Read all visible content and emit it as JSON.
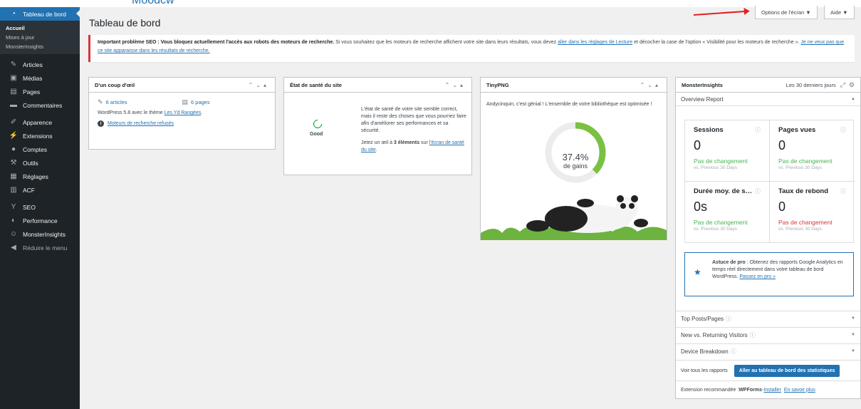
{
  "brand_fragment": "Moodcw",
  "sidebar": {
    "dashboard_label": "Tableau de bord",
    "submenu": [
      "Accueil",
      "Mises à jour",
      "MonsterInsights"
    ],
    "items": [
      {
        "label": "Articles",
        "icon": "pin-icon"
      },
      {
        "label": "Médias",
        "icon": "media-icon"
      },
      {
        "label": "Pages",
        "icon": "pages-icon"
      },
      {
        "label": "Commentaires",
        "icon": "comments-icon"
      },
      {
        "label": "Apparence",
        "icon": "appearance-icon"
      },
      {
        "label": "Extensions",
        "icon": "plugins-icon"
      },
      {
        "label": "Comptes",
        "icon": "users-icon"
      },
      {
        "label": "Outils",
        "icon": "tools-icon"
      },
      {
        "label": "Réglages",
        "icon": "settings-icon"
      },
      {
        "label": "ACF",
        "icon": "acf-icon"
      },
      {
        "label": "SEO",
        "icon": "seo-icon"
      },
      {
        "label": "Performance",
        "icon": "performance-icon"
      },
      {
        "label": "MonsterInsights",
        "icon": "monsterinsights-icon"
      },
      {
        "label": "Réduire le menu",
        "icon": "collapse-icon"
      }
    ]
  },
  "header": {
    "title": "Tableau de bord",
    "screen_options": "Options de l'écran ▼",
    "help": "Aide ▼"
  },
  "notice": {
    "bold": "Important problème SEO : Vous bloquez actuellement l'accès aux robots des moteurs de recherche.",
    "text1": " Si vous souhaitez que les moteurs de recherche affichent votre site dans leurs résultats, vous devez ",
    "link1": "aller dans les réglages de Lecture",
    "text2": " et décocher la case de l'option « Visibilité pour les moteurs de recherche ». ",
    "link2": "Je ne veux pas que ce site apparaisse dans les résultats de recherche."
  },
  "glance": {
    "title": "D'un coup d'œil",
    "articles": "6 articles",
    "pages": "6 pages",
    "version_text": "WordPress 5.8 avec le thème ",
    "theme_link": "Les Yd Rangées",
    "theme_after": ".",
    "seo_link": "Moteurs de recherche refusés"
  },
  "health": {
    "title": "État de santé du site",
    "status": "Good",
    "p1": "L'état de santé de votre site semble correct, mais il reste des choses que vous pourriez faire afin d'améliorer ses performances et sa sécurité.",
    "p2_a": "Jetez un œil à ",
    "p2_b": "3 éléments",
    "p2_c": " sur ",
    "p2_link": "l'écran de santé du site",
    "p2_d": "."
  },
  "tinypng": {
    "title": "TinyPNG",
    "message": "Andycinquin, c'est génial ! L'ensemble de votre bibliothèque est optimisée !",
    "percent_label": "37.4%",
    "percent_value": 37.4,
    "gains_label": "de gains"
  },
  "monsterinsights": {
    "title": "MonsterInsights",
    "period": "Les 30 derniers jours",
    "report": "Overview Report",
    "stats": [
      {
        "label": "Sessions",
        "value": "0",
        "change": "Pas de changement",
        "prev": "vs. Previous 30 Days",
        "color": "#46b450"
      },
      {
        "label": "Pages vues",
        "value": "0",
        "change": "Pas de changement",
        "prev": "vs. Previous 30 Days",
        "color": "#46b450"
      },
      {
        "label": "Durée moy. de s…",
        "value": "0s",
        "change": "Pas de changement",
        "prev": "vs. Previous 30 Days",
        "color": "#46b450"
      },
      {
        "label": "Taux de rebond",
        "value": "0",
        "change": "Pas de changement",
        "prev": "vs. Previous 30 Days",
        "color": "#d63638"
      }
    ],
    "tip_bold": "Astuce de pro",
    "tip_text": " : Obtenez des rapports Google Analytics en temps réel directement dans votre tableau de bord WordPress. ",
    "tip_link": "Passez en pro »",
    "sections": [
      "Top Posts/Pages",
      "New vs. Returning Visitors",
      "Device Breakdown"
    ],
    "all_reports": "Voir tous les rapports",
    "stats_button": "Aller au tableau de bord des statistiques",
    "recommended_text": "Extension recommandée : ",
    "recommended_name": "WPForms",
    "recommended_sep": " - ",
    "install_link": "Installer",
    "learn_link": "En savoir plus"
  },
  "colors": {
    "sidebar_bg": "#1d2327",
    "accent": "#2271b1",
    "notice_border": "#d63638",
    "gauge": "#7ac143",
    "positive": "#46b450",
    "negative": "#d63638"
  }
}
